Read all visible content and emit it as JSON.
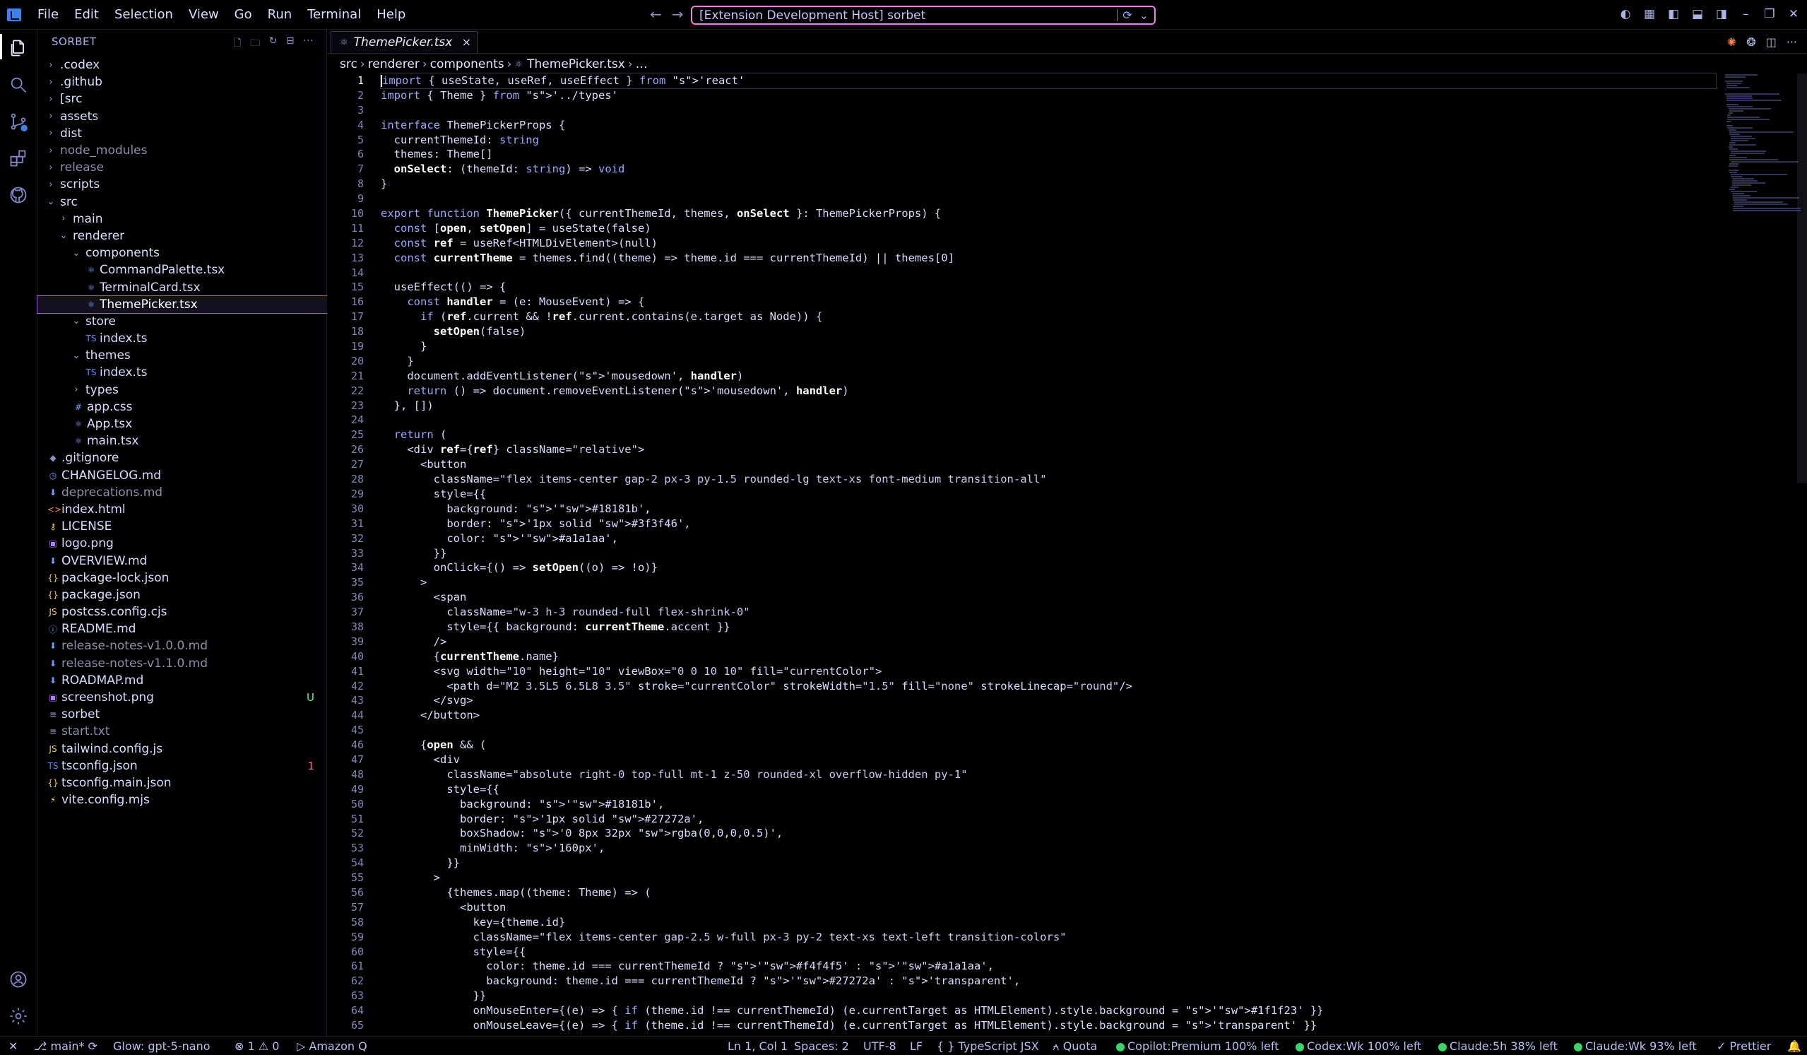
{
  "menu": [
    "File",
    "Edit",
    "Selection",
    "View",
    "Go",
    "Run",
    "Terminal",
    "Help"
  ],
  "search": {
    "text": "[Extension Development Host] sorbet"
  },
  "sidebar": {
    "title": "SORBET",
    "tree": [
      {
        "label": ".codex",
        "depth": 0,
        "kind": "folder",
        "open": false,
        "color": "#d7dcff"
      },
      {
        "label": ".github",
        "depth": 0,
        "kind": "folder",
        "open": false,
        "color": "#d7dcff"
      },
      {
        "label": "[src",
        "depth": 0,
        "kind": "folder",
        "open": false,
        "color": "#d7dcff"
      },
      {
        "label": "assets",
        "depth": 0,
        "kind": "folder",
        "open": false,
        "color": "#d7dcff"
      },
      {
        "label": "dist",
        "depth": 0,
        "kind": "folder",
        "open": false,
        "color": "#d7dcff"
      },
      {
        "label": "node_modules",
        "depth": 0,
        "kind": "folder",
        "open": false,
        "color": "#8c8fa8"
      },
      {
        "label": "release",
        "depth": 0,
        "kind": "folder",
        "open": false,
        "color": "#8c8fa8"
      },
      {
        "label": "scripts",
        "depth": 0,
        "kind": "folder",
        "open": false,
        "color": "#d7dcff"
      },
      {
        "label": "src",
        "depth": 0,
        "kind": "folder",
        "open": true,
        "color": "#d7dcff"
      },
      {
        "label": "main",
        "depth": 1,
        "kind": "folder",
        "open": false,
        "color": "#d7dcff"
      },
      {
        "label": "renderer",
        "depth": 1,
        "kind": "folder",
        "open": true,
        "color": "#d7dcff"
      },
      {
        "label": "components",
        "depth": 2,
        "kind": "folder",
        "open": true,
        "color": "#d7dcff"
      },
      {
        "label": "CommandPalette.tsx",
        "depth": 3,
        "kind": "file",
        "icon": "⚛",
        "iconColor": "#7aa6ff",
        "color": "#d7dcff"
      },
      {
        "label": "TerminalCard.tsx",
        "depth": 3,
        "kind": "file",
        "icon": "⚛",
        "iconColor": "#7aa6ff",
        "color": "#d7dcff"
      },
      {
        "label": "ThemePicker.tsx",
        "depth": 3,
        "kind": "file",
        "icon": "⚛",
        "iconColor": "#7aa6ff",
        "color": "#ffffff",
        "selected": true
      },
      {
        "label": "store",
        "depth": 2,
        "kind": "folder",
        "open": true,
        "color": "#d7dcff"
      },
      {
        "label": "index.ts",
        "depth": 3,
        "kind": "file",
        "icon": "TS",
        "iconColor": "#6b8cff",
        "color": "#d7dcff"
      },
      {
        "label": "themes",
        "depth": 2,
        "kind": "folder",
        "open": true,
        "color": "#d7dcff"
      },
      {
        "label": "index.ts",
        "depth": 3,
        "kind": "file",
        "icon": "TS",
        "iconColor": "#6b8cff",
        "color": "#d7dcff"
      },
      {
        "label": "types",
        "depth": 2,
        "kind": "folder",
        "open": false,
        "color": "#d7dcff"
      },
      {
        "label": "app.css",
        "depth": 2,
        "kind": "file",
        "icon": "#",
        "iconColor": "#7aa6ff",
        "color": "#d7dcff"
      },
      {
        "label": "App.tsx",
        "depth": 2,
        "kind": "file",
        "icon": "⚛",
        "iconColor": "#7aa6ff",
        "color": "#d7dcff"
      },
      {
        "label": "main.tsx",
        "depth": 2,
        "kind": "file",
        "icon": "⚛",
        "iconColor": "#7aa6ff",
        "color": "#d7dcff"
      },
      {
        "label": ".gitignore",
        "depth": 0,
        "kind": "file",
        "icon": "◆",
        "iconColor": "#8891c4",
        "color": "#d7dcff"
      },
      {
        "label": "CHANGELOG.md",
        "depth": 0,
        "kind": "file",
        "icon": "◷",
        "iconColor": "#6ba0ff",
        "color": "#d7dcff"
      },
      {
        "label": "deprecations.md",
        "depth": 0,
        "kind": "file",
        "icon": "⬇",
        "iconColor": "#6ba0ff",
        "color": "#8c8fa8"
      },
      {
        "label": "index.html",
        "depth": 0,
        "kind": "file",
        "icon": "<>",
        "iconColor": "#ff8a5c",
        "color": "#d7dcff"
      },
      {
        "label": "LICENSE",
        "depth": 0,
        "kind": "file",
        "icon": "⚷",
        "iconColor": "#f2c94c",
        "color": "#d7dcff"
      },
      {
        "label": "logo.png",
        "depth": 0,
        "kind": "file",
        "icon": "▣",
        "iconColor": "#b57cff",
        "color": "#d7dcff"
      },
      {
        "label": "OVERVIEW.md",
        "depth": 0,
        "kind": "file",
        "icon": "⬇",
        "iconColor": "#6ba0ff",
        "color": "#d7dcff"
      },
      {
        "label": "package-lock.json",
        "depth": 0,
        "kind": "file",
        "icon": "{}",
        "iconColor": "#f2c94c",
        "color": "#d7dcff"
      },
      {
        "label": "package.json",
        "depth": 0,
        "kind": "file",
        "icon": "{}",
        "iconColor": "#f2c94c",
        "color": "#d7dcff"
      },
      {
        "label": "postcss.config.cjs",
        "depth": 0,
        "kind": "file",
        "icon": "JS",
        "iconColor": "#f2c94c",
        "color": "#d7dcff"
      },
      {
        "label": "README.md",
        "depth": 0,
        "kind": "file",
        "icon": "ⓘ",
        "iconColor": "#6ba0ff",
        "color": "#d7dcff"
      },
      {
        "label": "release-notes-v1.0.0.md",
        "depth": 0,
        "kind": "file",
        "icon": "⬇",
        "iconColor": "#6ba0ff",
        "color": "#8c8fa8"
      },
      {
        "label": "release-notes-v1.1.0.md",
        "depth": 0,
        "kind": "file",
        "icon": "⬇",
        "iconColor": "#6ba0ff",
        "color": "#8c8fa8"
      },
      {
        "label": "ROADMAP.md",
        "depth": 0,
        "kind": "file",
        "icon": "⬇",
        "iconColor": "#6ba0ff",
        "color": "#d7dcff"
      },
      {
        "label": "screenshot.png",
        "depth": 0,
        "kind": "file",
        "icon": "▣",
        "iconColor": "#b57cff",
        "color": "#d7dcff",
        "badge": "U",
        "badgeColor": "#6ee7a8"
      },
      {
        "label": "sorbet",
        "depth": 0,
        "kind": "file",
        "icon": "≡",
        "iconColor": "#a6aee0",
        "color": "#d7dcff"
      },
      {
        "label": "start.txt",
        "depth": 0,
        "kind": "file",
        "icon": "≡",
        "iconColor": "#a6aee0",
        "color": "#8c8fa8"
      },
      {
        "label": "tailwind.config.js",
        "depth": 0,
        "kind": "file",
        "icon": "JS",
        "iconColor": "#f2c94c",
        "color": "#d7dcff"
      },
      {
        "label": "tsconfig.json",
        "depth": 0,
        "kind": "file",
        "icon": "TS",
        "iconColor": "#6b8cff",
        "color": "#d7dcff",
        "badge": "1",
        "badgeColor": "#ff6b8a"
      },
      {
        "label": "tsconfig.main.json",
        "depth": 0,
        "kind": "file",
        "icon": "{}",
        "iconColor": "#f2c94c",
        "color": "#d7dcff"
      },
      {
        "label": "vite.config.mjs",
        "depth": 0,
        "kind": "file",
        "icon": "⚡",
        "iconColor": "#f2c94c",
        "color": "#d7dcff"
      }
    ]
  },
  "tab": {
    "label": "ThemePicker.tsx",
    "close": "×"
  },
  "breadcrumbs": [
    "src",
    "renderer",
    "components",
    "ThemePicker.tsx",
    "…"
  ],
  "code": [
    "import { useState, useRef, useEffect } from 'react'",
    "import { Theme } from '../types'",
    "",
    "interface ThemePickerProps {",
    "  currentThemeId: string",
    "  themes: Theme[]",
    "  onSelect: (themeId: string) => void",
    "}",
    "",
    "export function ThemePicker({ currentThemeId, themes, onSelect }: ThemePickerProps) {",
    "  const [open, setOpen] = useState(false)",
    "  const ref = useRef<HTMLDivElement>(null)",
    "  const currentTheme = themes.find((theme) => theme.id === currentThemeId) || themes[0]",
    "",
    "  useEffect(() => {",
    "    const handler = (e: MouseEvent) => {",
    "      if (ref.current && !ref.current.contains(e.target as Node)) {",
    "        setOpen(false)",
    "      }",
    "    }",
    "    document.addEventListener('mousedown', handler)",
    "    return () => document.removeEventListener('mousedown', handler)",
    "  }, [])",
    "",
    "  return (",
    "    <div ref={ref} className=\"relative\">",
    "      <button",
    "        className=\"flex items-center gap-2 px-3 py-1.5 rounded-lg text-xs font-medium transition-all\"",
    "        style={{",
    "          background: '■#18181b',",
    "          border: '1px solid ■#3f3f46',",
    "          color: '■#a1a1aa',",
    "        }}",
    "        onClick={() => setOpen((o) => !o)}",
    "      >",
    "        <span",
    "          className=\"w-3 h-3 rounded-full flex-shrink-0\"",
    "          style={{ background: currentTheme.accent }}",
    "        />",
    "        {currentTheme.name}",
    "        <svg width=\"10\" height=\"10\" viewBox=\"0 0 10 10\" fill=\"currentColor\">",
    "          <path d=\"M2 3.5L5 6.5L8 3.5\" stroke=\"currentColor\" strokeWidth=\"1.5\" fill=\"none\" strokeLinecap=\"round\"/>",
    "        </svg>",
    "      </button>",
    "",
    "      {open && (",
    "        <div",
    "          className=\"absolute right-0 top-full mt-1 z-50 rounded-xl overflow-hidden py-1\"",
    "          style={{",
    "            background: '■#18181b',",
    "            border: '1px solid ■#27272a',",
    "            boxShadow: '0 8px 32px ■rgba(0,0,0,0.5)',",
    "            minWidth: '160px',",
    "          }}",
    "        >",
    "          {themes.map((theme: Theme) => (",
    "            <button",
    "              key={theme.id}",
    "              className=\"flex items-center gap-2.5 w-full px-3 py-2 text-xs text-left transition-colors\"",
    "              style={{",
    "                color: theme.id === currentThemeId ? '■#f4f4f5' : '■#a1a1aa',",
    "                background: theme.id === currentThemeId ? '■#27272a' : 'transparent',",
    "              }}",
    "              onMouseEnter={(e) => { if (theme.id !== currentThemeId) (e.currentTarget as HTMLElement).style.background = '■#1f1f23' }}",
    "              onMouseLeave={(e) => { if (theme.id !== currentThemeId) (e.currentTarget as HTMLElement).style.background = 'transparent' }}"
  ],
  "status": {
    "branch": "main*",
    "glow": "Glow: gpt-5-nano",
    "problems": "⊗ 1 ⚠ 0",
    "amazon": "Amazon Q",
    "position": "Ln 1, Col 1",
    "spaces": "Spaces: 2",
    "encoding": "UTF-8",
    "eol": "LF",
    "language": "{ } TypeScript JSX",
    "quota": "Quota",
    "copilot": "Copilot:Premium 100% left",
    "codex": "Codex:Wk 100% left",
    "claude5h": "Claude:5h 38% left",
    "claudewk": "Claude:Wk 93% left",
    "prettier": "Prettier"
  }
}
